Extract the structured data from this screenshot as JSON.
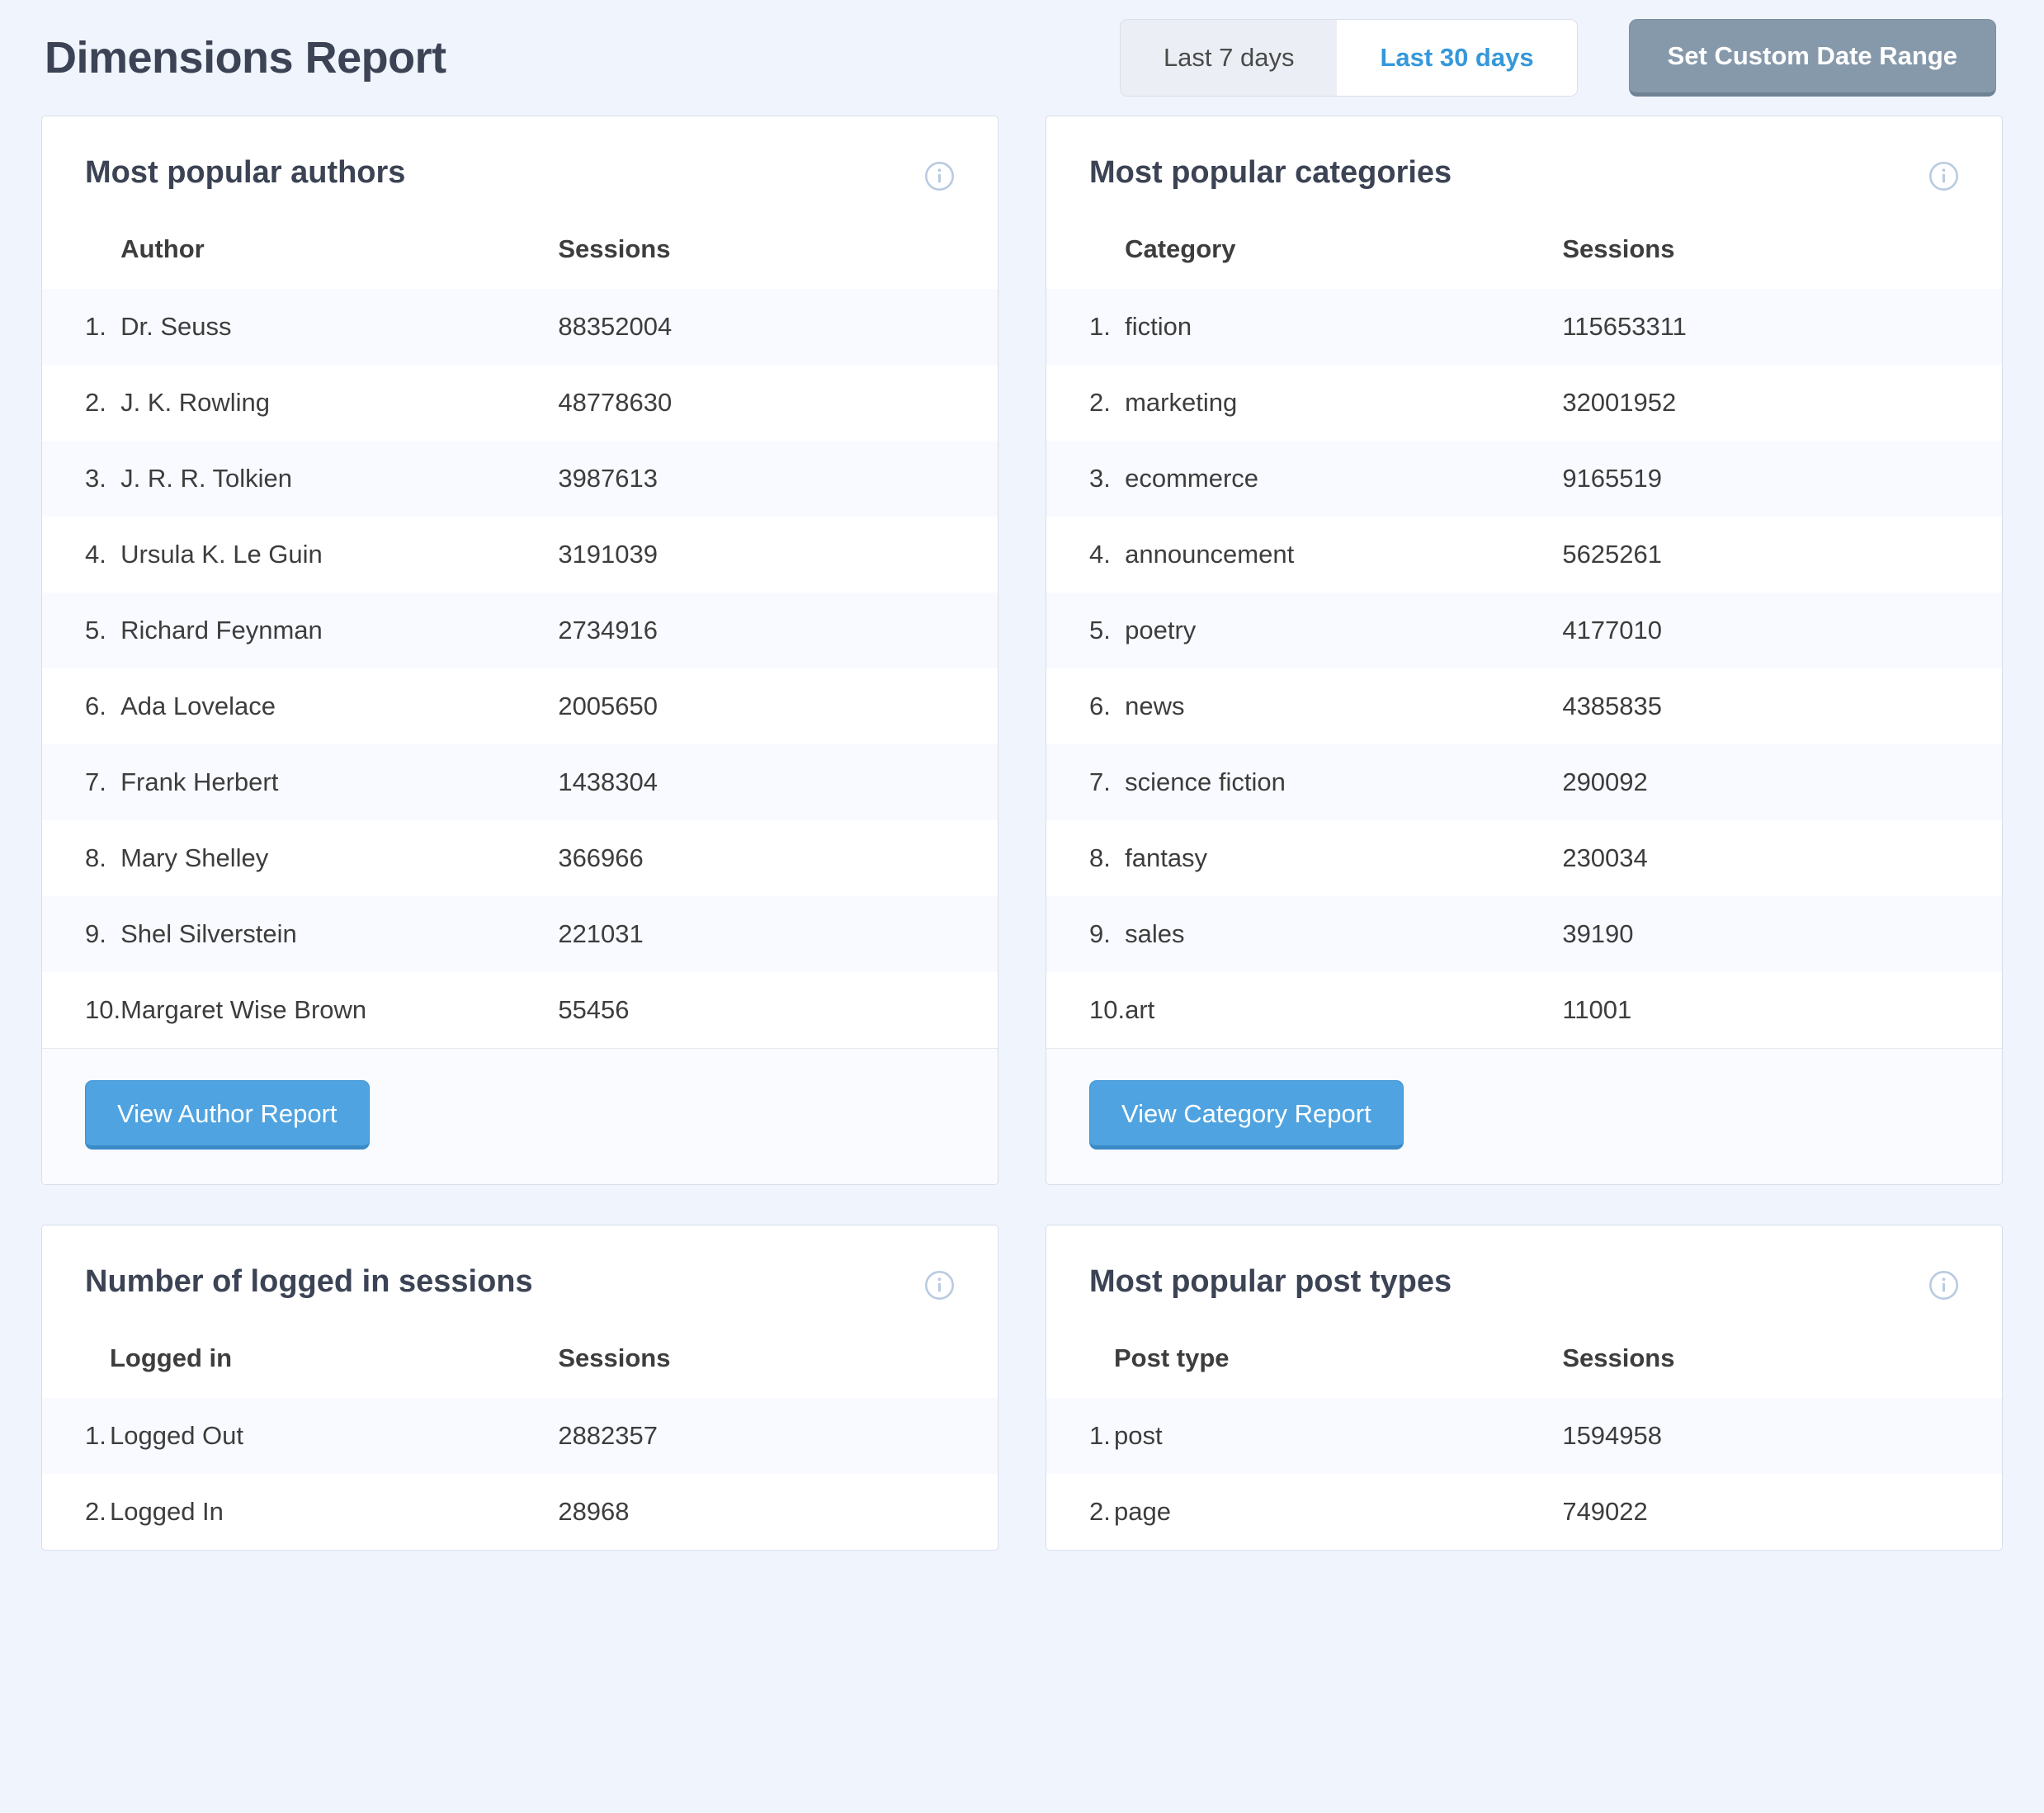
{
  "header": {
    "title": "Dimensions Report",
    "date_toggle": [
      {
        "label": "Last 7 days",
        "active": false
      },
      {
        "label": "Last 30 days",
        "active": true
      }
    ],
    "custom_range_button": "Set Custom Date Range"
  },
  "icons": {
    "info": "info-icon"
  },
  "colors": {
    "page_background": "#f0f4fd",
    "card_background": "#ffffff",
    "card_border": "#d6dfe8",
    "title_text": "#3b4354",
    "accent_blue": "#3498db",
    "button_blue": "#4fa3e0",
    "button_slate": "#8699ab",
    "rank_text": "#7b8ba5",
    "row_stripe": "#f8faff"
  },
  "cards": [
    {
      "title": "Most popular authors",
      "columns": [
        "Author",
        "Sessions"
      ],
      "rows": [
        {
          "rank": "1.",
          "label": "Dr. Seuss",
          "value": "88352004"
        },
        {
          "rank": "2.",
          "label": "J. K. Rowling",
          "value": "48778630"
        },
        {
          "rank": "3.",
          "label": "J. R. R. Tolkien",
          "value": "3987613"
        },
        {
          "rank": "4.",
          "label": "Ursula K. Le Guin",
          "value": "3191039"
        },
        {
          "rank": "5.",
          "label": "Richard Feynman",
          "value": "2734916"
        },
        {
          "rank": "6.",
          "label": "Ada Lovelace",
          "value": "2005650"
        },
        {
          "rank": "7.",
          "label": "Frank Herbert",
          "value": "1438304"
        },
        {
          "rank": "8.",
          "label": "Mary Shelley",
          "value": "366966"
        },
        {
          "rank": "9.",
          "label": "Shel Silverstein",
          "value": "221031"
        },
        {
          "rank": "10.",
          "label": "Margaret Wise Brown",
          "value": "55456"
        }
      ],
      "footer_button": "View Author Report"
    },
    {
      "title": "Most popular categories",
      "columns": [
        "Category",
        "Sessions"
      ],
      "rows": [
        {
          "rank": "1.",
          "label": "fiction",
          "value": "115653311"
        },
        {
          "rank": "2.",
          "label": "marketing",
          "value": "32001952"
        },
        {
          "rank": "3.",
          "label": "ecommerce",
          "value": "9165519"
        },
        {
          "rank": "4.",
          "label": "announcement",
          "value": "5625261"
        },
        {
          "rank": "5.",
          "label": "poetry",
          "value": "4177010"
        },
        {
          "rank": "6.",
          "label": "news",
          "value": "4385835"
        },
        {
          "rank": "7.",
          "label": "science fiction",
          "value": "290092"
        },
        {
          "rank": "8.",
          "label": "fantasy",
          "value": "230034"
        },
        {
          "rank": "9.",
          "label": "sales",
          "value": "39190"
        },
        {
          "rank": "10.",
          "label": "art",
          "value": "11001"
        }
      ],
      "footer_button": "View Category Report"
    },
    {
      "title": "Number of logged in sessions",
      "columns": [
        "Logged in",
        "Sessions"
      ],
      "rows": [
        {
          "rank": "1.",
          "label": "Logged Out",
          "value": "2882357"
        },
        {
          "rank": "2.",
          "label": "Logged In",
          "value": "28968"
        }
      ],
      "footer_button": null
    },
    {
      "title": "Most popular post types",
      "columns": [
        "Post type",
        "Sessions"
      ],
      "rows": [
        {
          "rank": "1.",
          "label": "post",
          "value": "1594958"
        },
        {
          "rank": "2.",
          "label": "page",
          "value": "749022"
        }
      ],
      "footer_button": null
    }
  ]
}
